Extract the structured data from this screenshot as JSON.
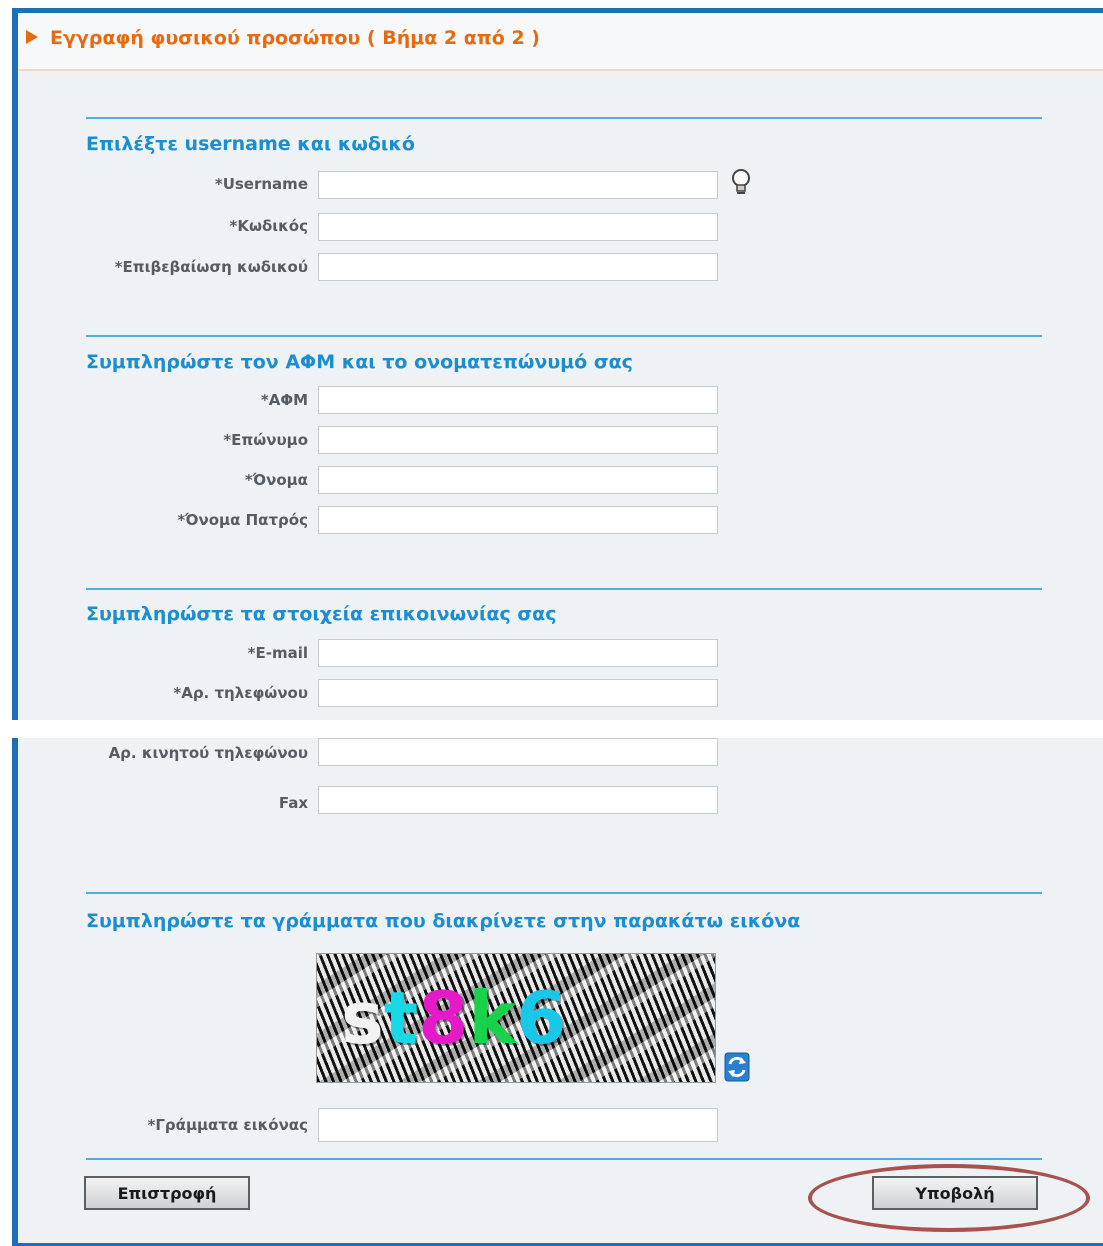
{
  "header": {
    "title": "Εγγραφή φυσικού προσώπου ( Βήμα 2 από 2 )"
  },
  "section_account": {
    "title": "Επιλέξτε username και κωδικό",
    "username_label": "*Username",
    "password_label": "*Κωδικός",
    "confirm_label": "*Επιβεβαίωση κωδικού"
  },
  "section_identity": {
    "title": "Συμπληρώστε τον ΑΦΜ και το ονοματεπώνυμό σας",
    "afm_label": "*ΑΦΜ",
    "surname_label": "*Επώνυμο",
    "name_label": "*Όνομα",
    "father_label": "*Όνομα Πατρός"
  },
  "section_contact": {
    "title": "Συμπληρώστε τα στοιχεία επικοινωνίας σας",
    "email_label": "*E-mail",
    "phone_label": "*Αρ. τηλεφώνου",
    "mobile_label": "Αρ. κινητού τηλεφώνου",
    "fax_label": "Fax"
  },
  "section_captcha": {
    "title": "Συμπληρώστε τα γράμματα που διακρίνετε στην παρακάτω εικόνα",
    "chars": [
      "s",
      "t",
      "8",
      "k",
      "6"
    ],
    "colors": [
      "#f2f2f2",
      "#19d8e6",
      "#e619c8",
      "#19d24b",
      "#19c8e8"
    ],
    "input_label": "*Γράμματα εικόνας",
    "refresh_icon": "refresh-icon"
  },
  "icons": {
    "hint": "lightbulb-icon"
  },
  "footer": {
    "back_label": "Επιστροφή",
    "submit_label": "Υποβολή"
  },
  "annotation_color": "#a8514e"
}
